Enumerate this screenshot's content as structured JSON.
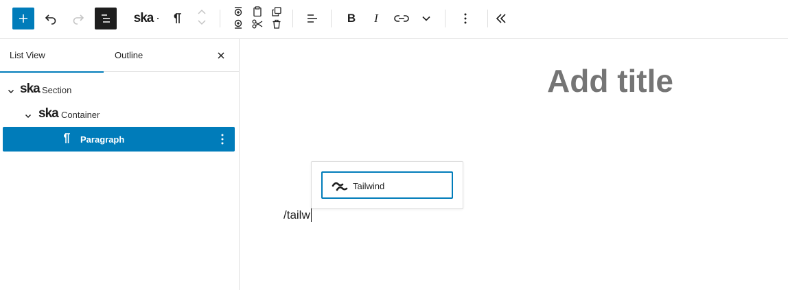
{
  "toolbar": {
    "add_block_icon": "plus-icon",
    "undo_icon": "undo-icon",
    "redo_icon": "redo-icon",
    "list_view_icon": "list-view-icon",
    "block_logo_text": "ska",
    "block_type_icon": "pilcrow-icon",
    "bold_label": "B",
    "italic_label": "I",
    "colors": {
      "accent": "#007cba",
      "dark": "#1e1e1e",
      "muted": "#c4c4c4"
    }
  },
  "sidebar": {
    "tabs": [
      {
        "label": "List View",
        "active": true
      },
      {
        "label": "Outline",
        "active": false
      }
    ],
    "tree": [
      {
        "logo": "ska",
        "label": "Section",
        "level": 1,
        "expanded": true
      },
      {
        "logo": "ska",
        "label": "Container",
        "level": 2,
        "expanded": true
      },
      {
        "label": "Paragraph",
        "level": 3,
        "selected": true
      }
    ]
  },
  "editor": {
    "title_placeholder": "Add title",
    "paragraph_text": "/tailw",
    "inserter": {
      "items": [
        {
          "label": "Tailwind",
          "icon": "tailwind-icon"
        }
      ]
    }
  }
}
